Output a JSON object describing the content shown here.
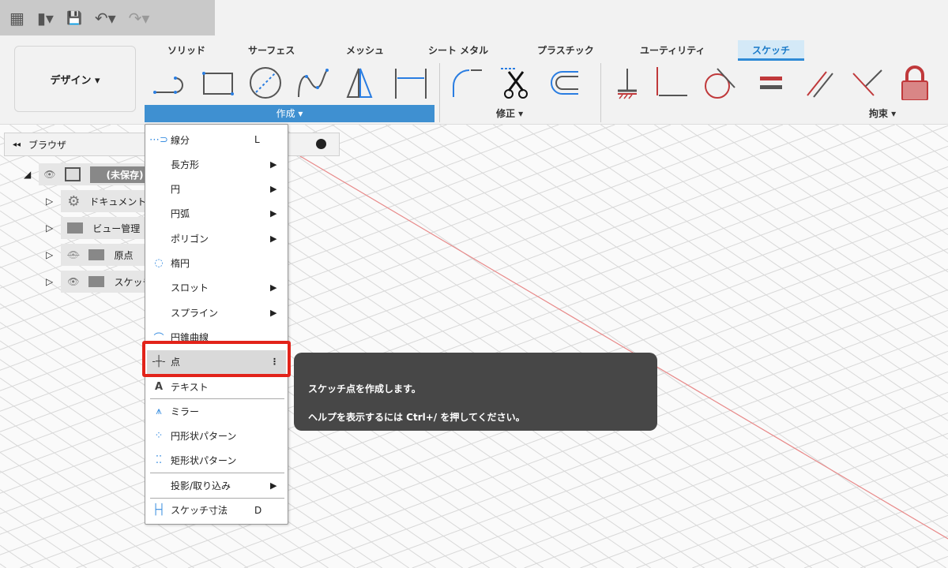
{
  "quick_access": {
    "apps": "▦",
    "file": "▮▾",
    "save": "💾",
    "undo": "↶▾",
    "redo": "↷▾"
  },
  "ribbon": {
    "workspace": "デザイン ▾",
    "tabs": [
      "ソリッド",
      "サーフェス",
      "メッシュ",
      "シート メタル",
      "プラスチック",
      "ユーティリティ",
      "スケッチ"
    ],
    "active_tab": "スケッチ",
    "groups": {
      "create": "作成 ▾",
      "modify": "修正 ▾",
      "constraints": "拘束 ▾"
    }
  },
  "browser": {
    "title": "ブラウザ",
    "collapse": "◂◂",
    "items": [
      {
        "label": "(未保存)"
      },
      {
        "label": "ドキュメントの設定"
      },
      {
        "label": "ビュー管理"
      },
      {
        "label": "原点"
      },
      {
        "label": "スケッチ"
      }
    ]
  },
  "menu": {
    "items": [
      {
        "label": "線分",
        "shortcut": "L"
      },
      {
        "label": "長方形",
        "submenu": "▶"
      },
      {
        "label": "円",
        "submenu": "▶"
      },
      {
        "label": "円弧",
        "submenu": "▶"
      },
      {
        "label": "ポリゴン",
        "submenu": "▶"
      },
      {
        "label": "楕円"
      },
      {
        "label": "スロット",
        "submenu": "▶"
      },
      {
        "label": "スプライン",
        "submenu": "▶"
      },
      {
        "label": "円錐曲線"
      },
      {
        "label": "点",
        "more": "⋮"
      },
      {
        "label": "テキスト"
      },
      {
        "label": "ミラー"
      },
      {
        "label": "円形状パターン"
      },
      {
        "label": "矩形状パターン"
      },
      {
        "label": "投影/取り込み",
        "submenu": "▶"
      },
      {
        "label": "スケッチ寸法",
        "shortcut": "D"
      }
    ]
  },
  "tooltip": {
    "line1": "スケッチ点を作成します。",
    "line2": "ヘルプを表示するには Ctrl+/ を押してください。"
  },
  "colors": {
    "accent": "#3f90d1",
    "highlight": "#e2231a",
    "tooltip_bg": "#474747",
    "constraint": "#c0393b"
  }
}
